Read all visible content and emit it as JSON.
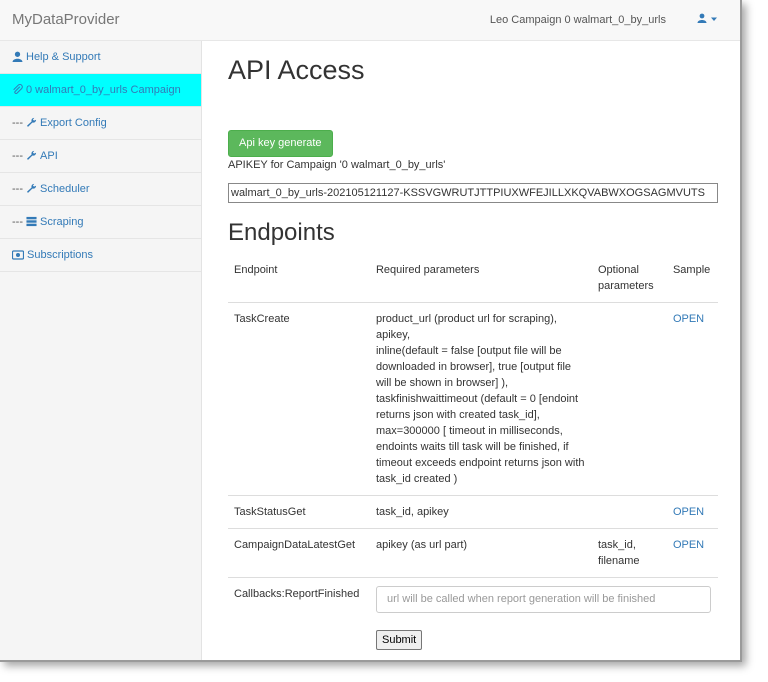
{
  "app": {
    "brand": "MyDataProvider",
    "user_label": "Leo Campaign 0 walmart_0_by_urls"
  },
  "sidebar": {
    "items": [
      {
        "prefix": "",
        "label": "Help & Support",
        "icon": "user-icon"
      },
      {
        "prefix": "",
        "label": "0 walmart_0_by_urls Campaign",
        "icon": "paperclip-icon"
      },
      {
        "prefix": "--- ",
        "label": "Export Config",
        "icon": "wrench-icon"
      },
      {
        "prefix": "--- ",
        "label": "API",
        "icon": "wrench-icon"
      },
      {
        "prefix": "--- ",
        "label": "Scheduler",
        "icon": "wrench-icon"
      },
      {
        "prefix": "--- ",
        "label": "Scraping",
        "icon": "tasks-icon"
      },
      {
        "prefix": "",
        "label": "Subscriptions",
        "icon": "camera-icon"
      }
    ]
  },
  "main": {
    "title": "API Access",
    "generate_button": "Api key generate",
    "apikey_label": "APIKEY for Campaign '0 walmart_0_by_urls'",
    "apikey_value": "walmart_0_by_urls-202105121127-KSSVGWRUTJTTPIUXWFEJILLXKQVABWXOGSAGMVUTS",
    "endpoints_title": "Endpoints",
    "table": {
      "headers": [
        "Endpoint",
        "Required parameters",
        "Optional parameters",
        "Sample"
      ],
      "rows": [
        {
          "endpoint": "TaskCreate",
          "required_lines": [
            "product_url (product url for scraping),",
            "apikey,",
            "inline(default = false [output file will be downloaded in browser], true [output file will be shown in browser] ),",
            "taskfinishwaittimeout (default = 0 [endoint returns json with created task_id], max=300000 [ timeout in milliseconds, endoints waits till task will be finished, if timeout exceeds endpoint returns json with task_id created )"
          ],
          "optional": "",
          "sample": "OPEN"
        },
        {
          "endpoint": "TaskStatusGet",
          "required_lines": [
            "task_id, apikey"
          ],
          "optional": "",
          "sample": "OPEN"
        },
        {
          "endpoint": "CampaignDataLatestGet",
          "required_lines": [
            "apikey (as url part)"
          ],
          "optional": "task_id, filename",
          "sample": "OPEN"
        }
      ],
      "callback_row": {
        "endpoint": "Callbacks:ReportFinished",
        "placeholder": "url will be called when report generation will be finished",
        "submit": "Submit"
      }
    }
  },
  "colors": {
    "active_sidebar": "#00ffff",
    "link": "#337ab7",
    "generate_button": "#5cb85c"
  }
}
